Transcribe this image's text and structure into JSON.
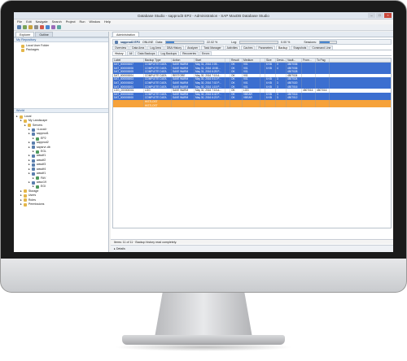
{
  "window": {
    "title": "Database Studio - sapprod3 EP2 - Administration - SAP MaxDB Database Studio"
  },
  "menu": [
    "File",
    "Edit",
    "Navigate",
    "Search",
    "Project",
    "Run",
    "Window",
    "Help"
  ],
  "left_panel": {
    "tabs": [
      "Explorer",
      "Outline"
    ],
    "repository_title": "My Repository",
    "repository_items": [
      "Local User Folder",
      "Packages"
    ],
    "world_title": "World",
    "tree": [
      {
        "label": "Local",
        "indent": 0,
        "icon": "folder"
      },
      {
        "label": "My Landscape",
        "indent": 1,
        "icon": "folder"
      },
      {
        "label": "Servers",
        "indent": 2,
        "icon": "folder"
      },
      {
        "label": "<Local>",
        "indent": 3,
        "icon": "db"
      },
      {
        "label": "sapprod1",
        "indent": 3,
        "icon": "db"
      },
      {
        "label": "EP2",
        "indent": 4,
        "icon": "sys"
      },
      {
        "label": "sapprod2",
        "indent": 3,
        "icon": "db"
      },
      {
        "label": "sapsrvr-db",
        "indent": 3,
        "icon": "db"
      },
      {
        "label": "EGL",
        "indent": 4,
        "icon": "sys"
      },
      {
        "label": "wasdf1",
        "indent": 3,
        "icon": "db"
      },
      {
        "label": "wasdf2",
        "indent": 3,
        "icon": "db"
      },
      {
        "label": "wasdf3",
        "indent": 3,
        "icon": "db"
      },
      {
        "label": "wasdf4",
        "indent": 3,
        "icon": "db"
      },
      {
        "label": "wasdf1",
        "indent": 3,
        "icon": "db"
      },
      {
        "label": "FAV",
        "indent": 4,
        "icon": "sys"
      },
      {
        "label": "wasx19",
        "indent": 3,
        "icon": "db"
      },
      {
        "label": "EGI",
        "indent": 4,
        "icon": "sys"
      },
      {
        "label": "Storage",
        "indent": 1,
        "icon": "folder"
      },
      {
        "label": "Users",
        "indent": 1,
        "icon": "folder"
      },
      {
        "label": "Roles",
        "indent": 1,
        "icon": "folder"
      },
      {
        "label": "Permissions",
        "indent": 1,
        "icon": "folder"
      }
    ]
  },
  "editor": {
    "tab": "Administration",
    "system": "sapprod3 EP2",
    "state": "ONLINE",
    "data_label": "Data:",
    "data_percent": "22.02 %",
    "data_fill": 0.22,
    "log_label": "Log:",
    "log_percent": "0.00 %",
    "log_fill": 0.0,
    "sessions_label": "Sessions:",
    "sessions_fill": 0.6,
    "section_tabs": [
      "Overview",
      "Data Area",
      "Log Area",
      "DBA History",
      "Analyzer",
      "Task Manager",
      "Activities",
      "Caches",
      "Parameters",
      "Backup",
      "Snapshots",
      "Command Line"
    ],
    "backup_tabs": [
      "History",
      "All",
      "Data Backups",
      "Log Backups",
      "Recoveries",
      "Errors"
    ],
    "columns": [
      "Label",
      "Backup Type",
      "Action",
      "Start",
      "",
      "Result",
      "Medium",
      "",
      "Size",
      "Devic...",
      "Vault...",
      "From...",
      "To Pag"
    ],
    "rows": [
      {
        "style": "sel",
        "cells": [
          "DAT_000000007",
          "COMPLETE DATA",
          "SAVE WARM",
          "May 31, 2016 2:09...",
          "",
          "OK",
          "V01",
          "",
          "6 KB",
          "3",
          "4507036",
          "",
          ""
        ]
      },
      {
        "style": "sel",
        "cells": [
          "DAT_000000006",
          "COMPLETE DATA",
          "SAVE WARM",
          "May 31, 2016 10:50...",
          "",
          "OK",
          "V01",
          "",
          "6 KB",
          "4",
          "4507036",
          "",
          ""
        ]
      },
      {
        "style": "sel",
        "cells": [
          "DAT_000000005",
          "COMPLETE DATA",
          "SAVE WARM",
          "May 31, 2016 6:25 P...",
          "",
          "OK",
          "V01",
          "",
          "",
          "",
          "4507028",
          "",
          ""
        ]
      },
      {
        "style": "wht",
        "cells": [
          "DAT_000000004",
          "COMPLETE DATA",
          "RESTORE",
          "May 30, 2016 7:15 A...",
          "",
          "OK",
          "V01",
          "",
          "",
          "",
          "4507024",
          "",
          ""
        ]
      },
      {
        "style": "sel",
        "cells": [
          "DAT_000000003",
          "COMPLETE DATA",
          "SAVE WARM",
          "May 30, 2016 5:10 P...",
          "",
          "OK",
          "V01",
          "",
          "6 KB",
          "3",
          "4507024",
          "",
          ""
        ]
      },
      {
        "style": "sel",
        "cells": [
          "DAT_000000002",
          "COMPLETE DATA",
          "SAVE WARM",
          "May 30, 2016 7:02 P...",
          "",
          "OK",
          "V01",
          "",
          "6 KB",
          "3",
          "4507020",
          "",
          ""
        ]
      },
      {
        "style": "sel",
        "cells": [
          "DAT_000000001",
          "COMPLETE DATA",
          "SAVE WARM",
          "May 30, 2016 1:15 P...",
          "",
          "OK",
          "V01",
          "",
          "6 KB",
          "3",
          "4507016",
          "",
          ""
        ]
      },
      {
        "style": "wht",
        "cells": [
          "LOG_000000001",
          "LOG",
          "SAVE WARM",
          "May 30, 2016 7:15 A...",
          "",
          "OK",
          "LOG",
          "",
          "",
          "",
          "",
          "4507016",
          "4507016"
        ]
      },
      {
        "style": "sel",
        "cells": [
          "DAT_000000000",
          "COMPLETE DATA",
          "SAVE WARM",
          "May 30, 2016 6:42 P...",
          "",
          "OK",
          "VBEAR",
          "",
          "6 KB",
          "3",
          "4507016",
          "",
          ""
        ]
      },
      {
        "style": "sel",
        "cells": [
          "DAT_000000000",
          "COMPLETE DATA",
          "SAVE WARM",
          "May 30, 2016 6:23 P...",
          "",
          "OK",
          "VBEAR",
          "",
          "6 KB",
          "3",
          "4507012",
          "",
          ""
        ]
      },
      {
        "style": "org",
        "cells": [
          "",
          "HISTLOST",
          "",
          "",
          "",
          "",
          "",
          "",
          "",
          "",
          "",
          "",
          ""
        ]
      },
      {
        "style": "org",
        "cells": [
          "",
          "HISTLOST",
          "",
          "",
          "",
          "",
          "",
          "",
          "",
          "",
          "",
          "",
          ""
        ]
      }
    ],
    "status_text": "Items: 11 of 11 · Backup history read completely.",
    "details_label": "Details"
  },
  "colors": {
    "selected_row": "#3c6fd0",
    "white_row": "#ffffff",
    "orange_row": "#f6a23a",
    "accent": "#1d4f91"
  }
}
